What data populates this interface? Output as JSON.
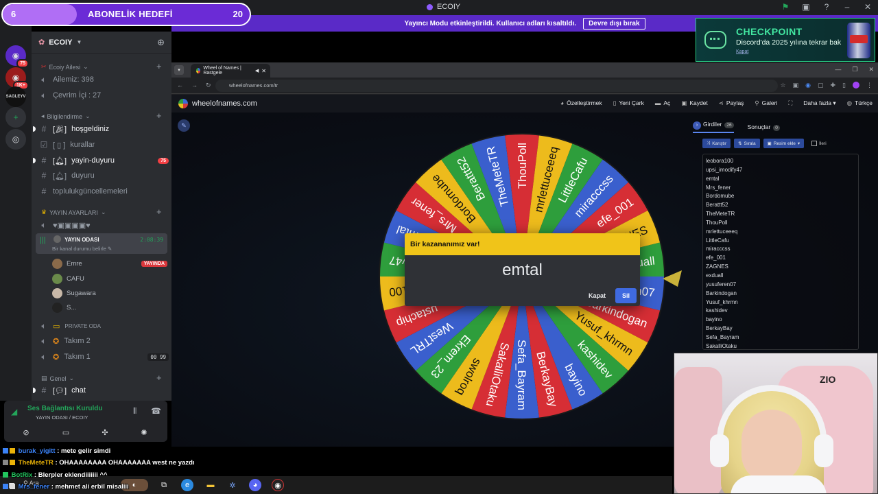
{
  "topbar": {
    "app_title": "ECOIY"
  },
  "goal": {
    "current": "6",
    "label": "ABONELİK HEDEFİ",
    "target": "20",
    "progress": 0.3
  },
  "banner": {
    "text": "Yayıncı Modu etkinleştirildi. Kullanıcı adları kısaltıldı.",
    "button": "Devre dışı bırak"
  },
  "ad": {
    "title": "CHECKPOINT",
    "subtitle": "Discord'da 2025 yılına tekrar bak",
    "close": "Kapat"
  },
  "rail": {
    "badges": [
      "75",
      "1K+"
    ],
    "server_tag": "SAGLEYV"
  },
  "server": {
    "name": "ECOIY"
  },
  "categories": {
    "c1": "Ecoiy Ailesi",
    "c2": "Bilgilendirme",
    "c3": "YAYIN AYARLARI",
    "c4": "PRIVATE ODA",
    "c5": "Genel"
  },
  "channels": {
    "ailemiz": "Ailemiz: 398",
    "cevrimici": "Çevrim İçi : 27",
    "hosgeldiniz": "hoşgeldiniz",
    "kurallar": "kurallar",
    "yayin_duyuru": "yayin-duyuru",
    "yayin_duyuru_badge": "75",
    "duyuru": "duyuru",
    "toplulukguncellemeleri": "toplulukgüncellemeleri",
    "yayin_odasi": "YAYIN ODASI",
    "yayin_odasi_status": "Bir kanal durumu belirle",
    "yayin_odasi_time": "2:08:39",
    "takim2": "Takım 2",
    "takim1": "Takım 1",
    "takim1_tag": "00 99",
    "chat": "chat"
  },
  "voice_users": [
    {
      "name": "Emre",
      "live": "YAYINDA",
      "color": "#8a6a4a"
    },
    {
      "name": "CAFU",
      "live": "",
      "color": "#6a8a4a"
    },
    {
      "name": "Sugawara",
      "live": "",
      "color": "#c8b8a8"
    },
    {
      "name": "S...",
      "live": "",
      "color": "#222"
    }
  ],
  "voice_panel": {
    "status": "Ses Bağlantısı Kuruldu",
    "sub": "YAYIN ODASI / ECOIY"
  },
  "browser": {
    "tab_title": "Wheel of Names | Rastgele",
    "url": "wheelofnames.com/tr"
  },
  "site": {
    "brand": "wheelofnames.com",
    "menu": [
      "Özelleştirmek",
      "Yeni Çark",
      "Aç",
      "Kaydet",
      "Paylaş",
      "Galeri",
      "Daha fazla",
      "Türkçe"
    ]
  },
  "entries_panel": {
    "tab_entries": "Girdiler",
    "tab_entries_count": "26",
    "tab_results": "Sonuçlar",
    "tab_results_count": "0",
    "btn_shuffle": "Karıştır",
    "btn_sort": "Sırala",
    "btn_add_image": "Resim ekle",
    "chk_advanced": "İleri",
    "items": [
      "leobora100",
      "upsi_imodify47",
      "emtal",
      "Mrs_fener",
      "Bordomube",
      "Berattt52",
      "TheMeteTR",
      "ThouPoll",
      "mrlettuceeeq",
      "LittleCafu",
      "miracccss",
      "efe_001",
      "ZAGNES",
      "exduall",
      "yusuferen07",
      "Barkindogan",
      "Yusuf_khrmn",
      "kashidev",
      "bayino",
      "BerkayBay",
      "Sefa_Bayram",
      "SakalliOtaku"
    ]
  },
  "wheel": {
    "colors": [
      "#3a5fcd",
      "#d62e35",
      "#edbb1c",
      "#2e9e3c"
    ],
    "segments": [
      "Sefa_Bayram",
      "SakalliOtaku",
      "swolroq",
      "Ekrem_23",
      "WestTRL",
      "ustachip",
      "leobora100",
      "upsi_imodify47",
      "emtal",
      "Mrs_fener",
      "Bordomube",
      "Berattt52",
      "TheMeteTR",
      "ThouPoll",
      "mrlettuceeeq",
      "LittleCafu",
      "miracccss",
      "efe_001",
      "ZAGNES",
      "exduall",
      "yusuferen07",
      "Barkindogan",
      "Yusuf_khrmn",
      "kashidev",
      "bayino",
      "BerkayBay"
    ]
  },
  "modal": {
    "title": "Bir kazananımız var!",
    "winner": "emtal",
    "close": "Kapat",
    "delete": "Sil"
  },
  "chat": [
    {
      "user": "burak_yigitt",
      "text": ": mete gelir simdi",
      "color": "#3b82f6"
    },
    {
      "user": "TheMeteTR",
      "text": ": OHAAAAAAAA OHAAAAAAA west ne yazdı",
      "color": "#eab308"
    },
    {
      "user": "BotRix",
      "text": ": Blerpler eklendiiiiiii ^^",
      "color": "#22c55e"
    },
    {
      "user": "Mrs_fener",
      "text": ": mehmet ali erbil misaliii",
      "color": "#3b82f6"
    }
  ],
  "taskbar": {
    "search": "Ara"
  }
}
